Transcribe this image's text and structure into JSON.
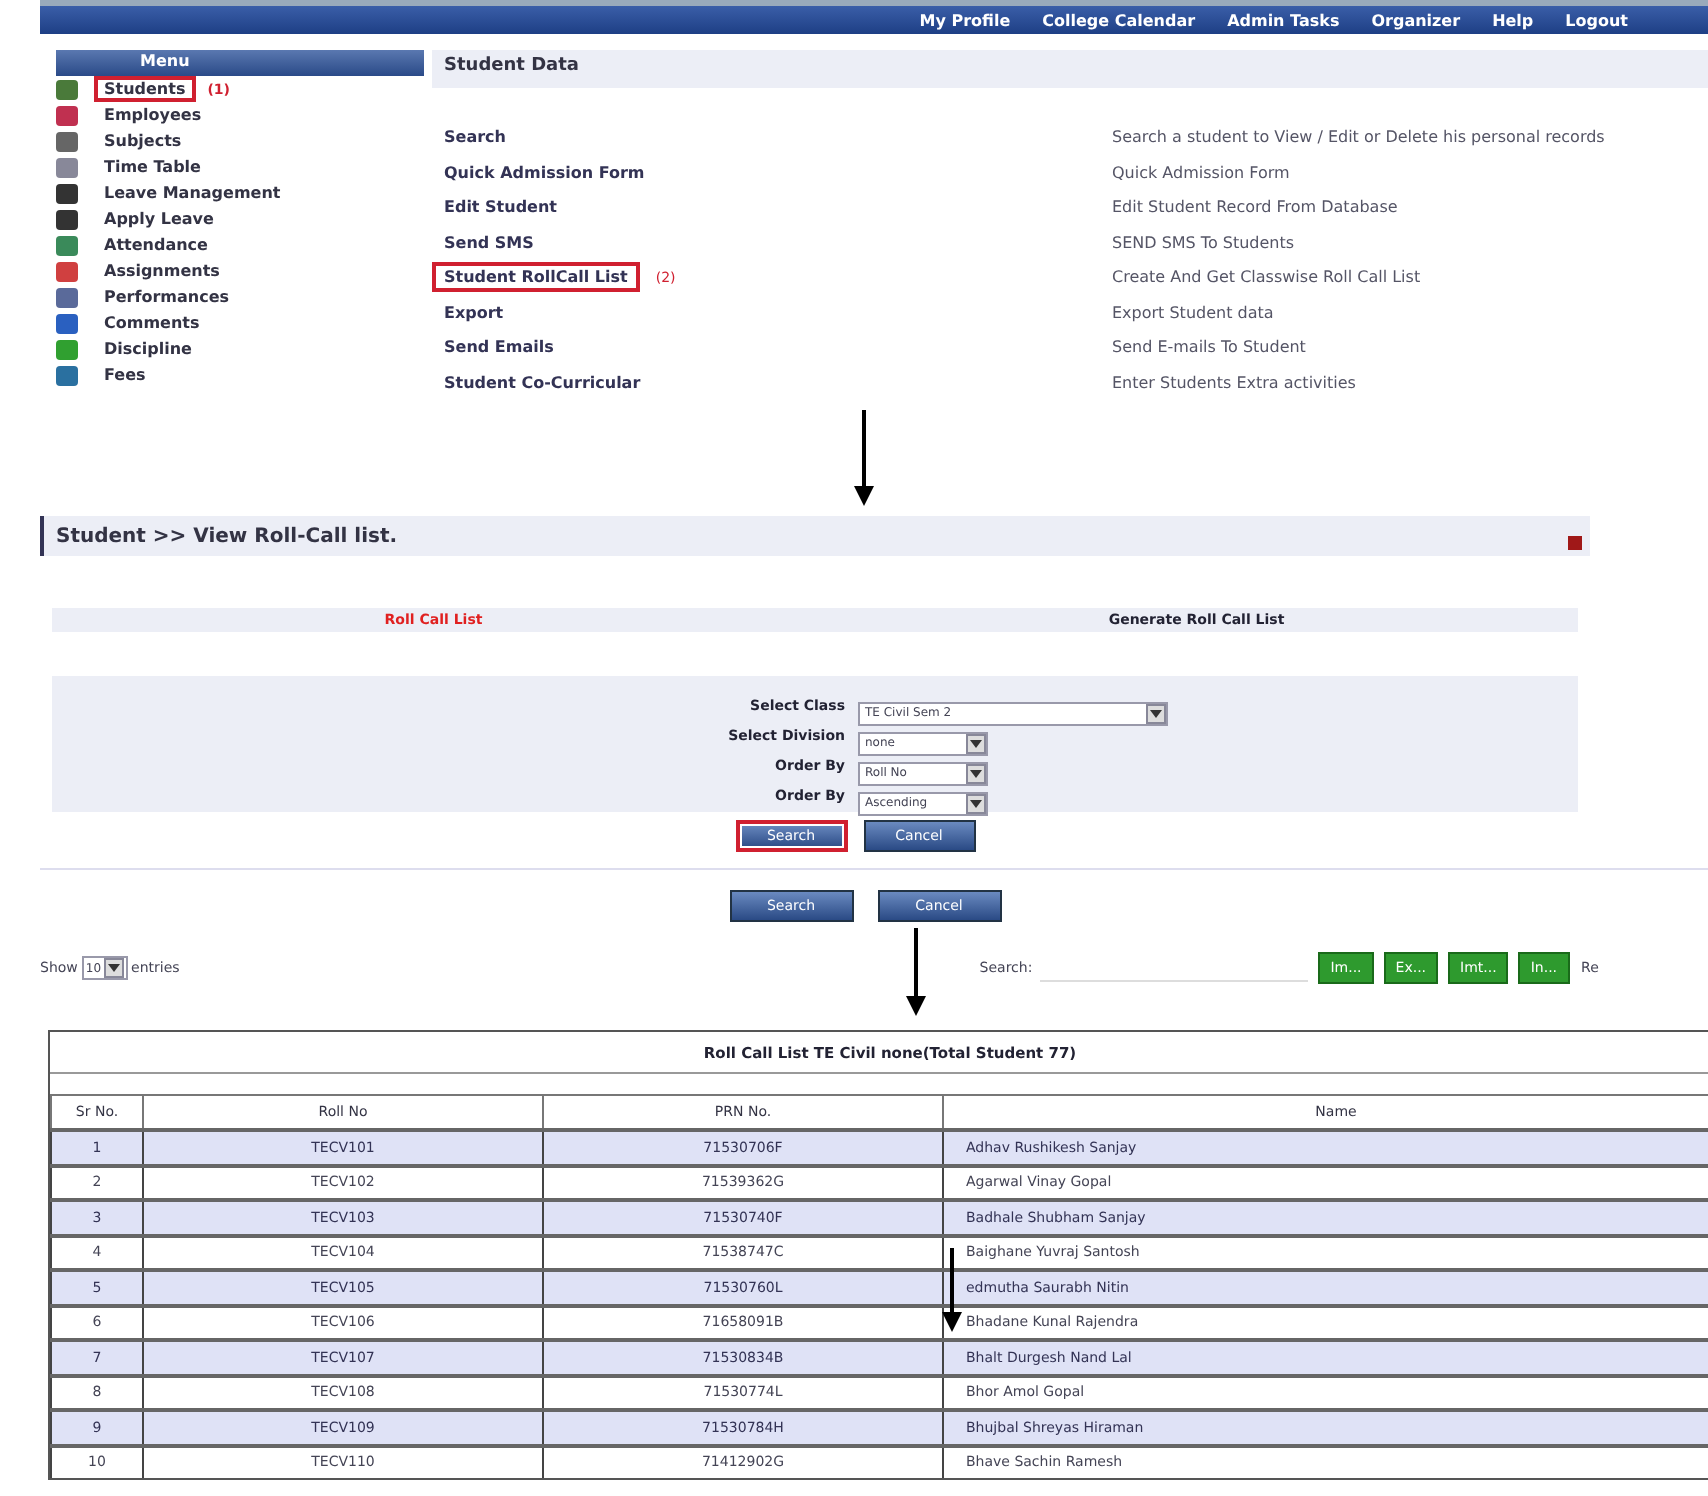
{
  "nav": {
    "links": [
      "My Profile",
      "College Calendar",
      "Admin Tasks",
      "Organizer",
      "Help",
      "Logout"
    ]
  },
  "menu": {
    "title": "Menu",
    "items": [
      {
        "label": "Students",
        "highlighted": true,
        "marker": "(1)"
      },
      {
        "label": "Employees",
        "highlighted": false
      },
      {
        "label": "Subjects",
        "highlighted": false
      },
      {
        "label": "Time Table",
        "highlighted": false
      },
      {
        "label": "Leave Management",
        "highlighted": false
      },
      {
        "label": "Apply Leave",
        "highlighted": false
      },
      {
        "label": "Attendance",
        "highlighted": false
      },
      {
        "label": "Assignments",
        "highlighted": false
      },
      {
        "label": "Performances",
        "highlighted": false
      },
      {
        "label": "Comments",
        "highlighted": false
      },
      {
        "label": "Discipline",
        "highlighted": false
      },
      {
        "label": "Fees",
        "highlighted": false
      }
    ]
  },
  "student_data": {
    "title": "Student Data",
    "items": [
      {
        "label": "Search",
        "description": "Search a student to View / Edit or Delete his personal records",
        "highlighted": false
      },
      {
        "label": "Quick Admission Form",
        "description": "Quick Admission Form",
        "highlighted": false
      },
      {
        "label": "Edit Student",
        "description": "Edit Student Record From Database",
        "highlighted": false
      },
      {
        "label": "Send SMS",
        "description": "SEND SMS To Students",
        "highlighted": false
      },
      {
        "label": "Student RollCall List",
        "description": "Create And Get Classwise Roll Call List",
        "highlighted": true,
        "marker": "(2)"
      },
      {
        "label": "Export",
        "description": "Export Student data",
        "highlighted": false
      },
      {
        "label": "Send Emails",
        "description": "Send E-mails To Student",
        "highlighted": false
      },
      {
        "label": "Student Co-Curricular",
        "description": "Enter Students Extra activities",
        "highlighted": false
      }
    ]
  },
  "roll_call": {
    "title": "Student >> View Roll-Call list.",
    "tabs": [
      {
        "label": "Roll Call List",
        "selected": true
      },
      {
        "label": "Generate Roll Call List",
        "selected": false
      }
    ],
    "fields": [
      {
        "label": "Select Class",
        "value": "TE Civil Sem 2"
      },
      {
        "label": "Select Division",
        "value": "none"
      },
      {
        "label": "Order By",
        "value": "Roll No"
      },
      {
        "label": "Order By",
        "value": "Ascending"
      }
    ],
    "buttons": [
      {
        "label": "Search",
        "highlighted": true
      },
      {
        "label": "Cancel",
        "highlighted": false
      }
    ]
  },
  "outer_buttons": [
    "Search",
    "Cancel"
  ],
  "table_tools": {
    "show_label": "Show",
    "entries_value": "10",
    "entries_label": "entries",
    "search_label": "Search:",
    "export_buttons": [
      "Im...",
      "Ex...",
      "Imt...",
      "In..."
    ],
    "cut_label": "Re"
  },
  "table": {
    "caption": "Roll Call List TE Civil none(Total Student 77)",
    "columns": [
      "Sr No.",
      "Roll No",
      "PRN No.",
      "Name"
    ],
    "rows": [
      [
        "1",
        "TECV101",
        "71530706F",
        "Adhav Rushikesh Sanjay"
      ],
      [
        "2",
        "TECV102",
        "71539362G",
        "Agarwal Vinay Gopal"
      ],
      [
        "3",
        "TECV103",
        "71530740F",
        "Badhale Shubham Sanjay"
      ],
      [
        "4",
        "TECV104",
        "71538747C",
        "Baighane Yuvraj Santosh"
      ],
      [
        "5",
        "TECV105",
        "71530760L",
        "edmutha Saurabh Nitin"
      ],
      [
        "6",
        "TECV106",
        "71658091B",
        "Bhadane Kunal Rajendra"
      ],
      [
        "7",
        "TECV107",
        "71530834B",
        "Bhalt Durgesh Nand Lal"
      ],
      [
        "8",
        "TECV108",
        "71530774L",
        "Bhor Amol Gopal"
      ],
      [
        "9",
        "TECV109",
        "71530784H",
        "Bhujbal Shreyas Hiraman"
      ],
      [
        "10",
        "TECV110",
        "71412902G",
        "Bhave Sachin Ramesh"
      ]
    ]
  }
}
